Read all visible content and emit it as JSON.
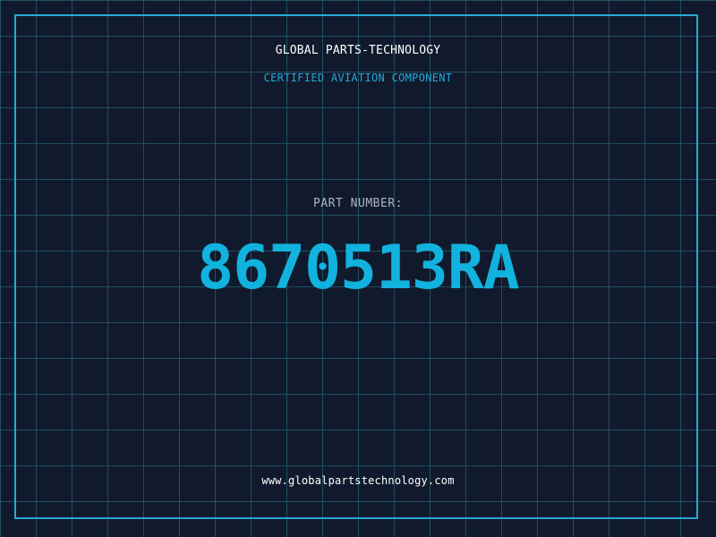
{
  "header": {
    "company_name": "GLOBAL PARTS-TECHNOLOGY",
    "tagline": "CERTIFIED AVIATION COMPONENT"
  },
  "part": {
    "label": "PART NUMBER:",
    "number": "8670513RA"
  },
  "footer": {
    "website": "www.globalpartstechnology.com"
  },
  "colors": {
    "background": "#111a2c",
    "grid": "#2c788c",
    "accent": "#22a9de",
    "part_number": "#12b2df",
    "label": "#aab4c4",
    "text": "#ffffff"
  }
}
